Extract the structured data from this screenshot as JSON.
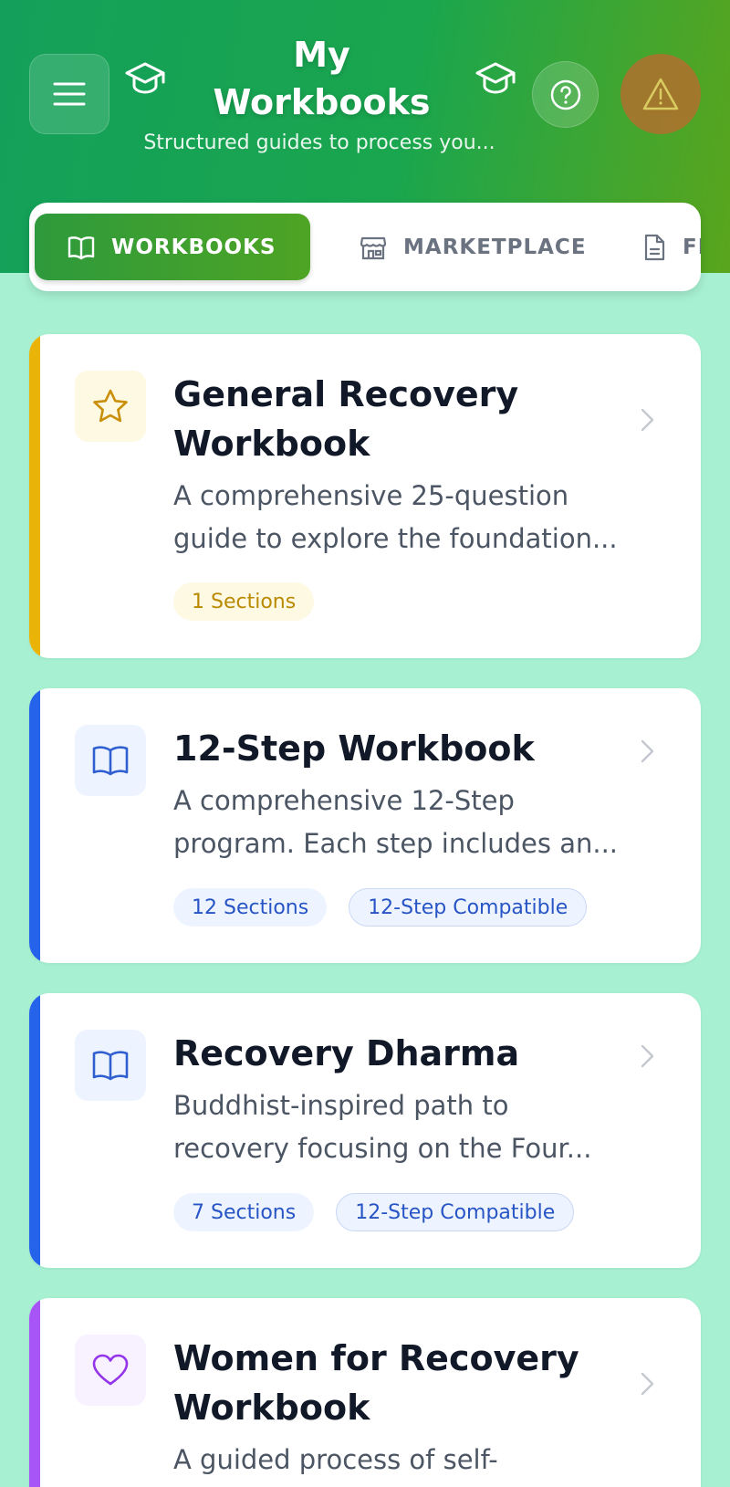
{
  "header": {
    "title_line1": "My",
    "title_line2": "Workbooks",
    "subtitle": "Structured guides to process you...",
    "menu_icon": "hamburger-icon",
    "left_icon": "graduation-cap-icon",
    "right_icon": "graduation-cap-icon",
    "help_icon": "question-circle-icon",
    "alert_icon": "warning-triangle-icon"
  },
  "tabs": [
    {
      "label": "WORKBOOKS",
      "icon": "book-open-icon",
      "active": true
    },
    {
      "label": "MARKETPLACE",
      "icon": "store-icon",
      "active": false
    },
    {
      "label": "FEL",
      "icon": "document-icon",
      "active": false
    }
  ],
  "workbooks": [
    {
      "title_lines": [
        "General Recovery",
        "Workbook"
      ],
      "desc_lines": [
        "A comprehensive 25-question",
        "guide to explore the foundation..."
      ],
      "icon": "star-icon",
      "accent": "#eab308",
      "badges": [
        "1 Sections"
      ]
    },
    {
      "title_lines": [
        "12-Step Workbook"
      ],
      "desc_lines": [
        "A comprehensive 12-Step",
        "program. Each step includes an..."
      ],
      "icon": "book-open-icon",
      "accent": "#2563eb",
      "badges": [
        "12 Sections",
        "12-Step Compatible"
      ]
    },
    {
      "title_lines": [
        "Recovery Dharma"
      ],
      "desc_lines": [
        "Buddhist-inspired path to",
        "recovery focusing on the Four..."
      ],
      "icon": "book-open-icon",
      "accent": "#2563eb",
      "badges": [
        "7 Sections",
        "12-Step Compatible"
      ]
    },
    {
      "title_lines": [
        "Women for Recovery",
        "Workbook"
      ],
      "desc_lines": [
        "A guided process of self-"
      ],
      "icon": "heart-icon",
      "accent": "#a855f7",
      "badges": []
    }
  ]
}
